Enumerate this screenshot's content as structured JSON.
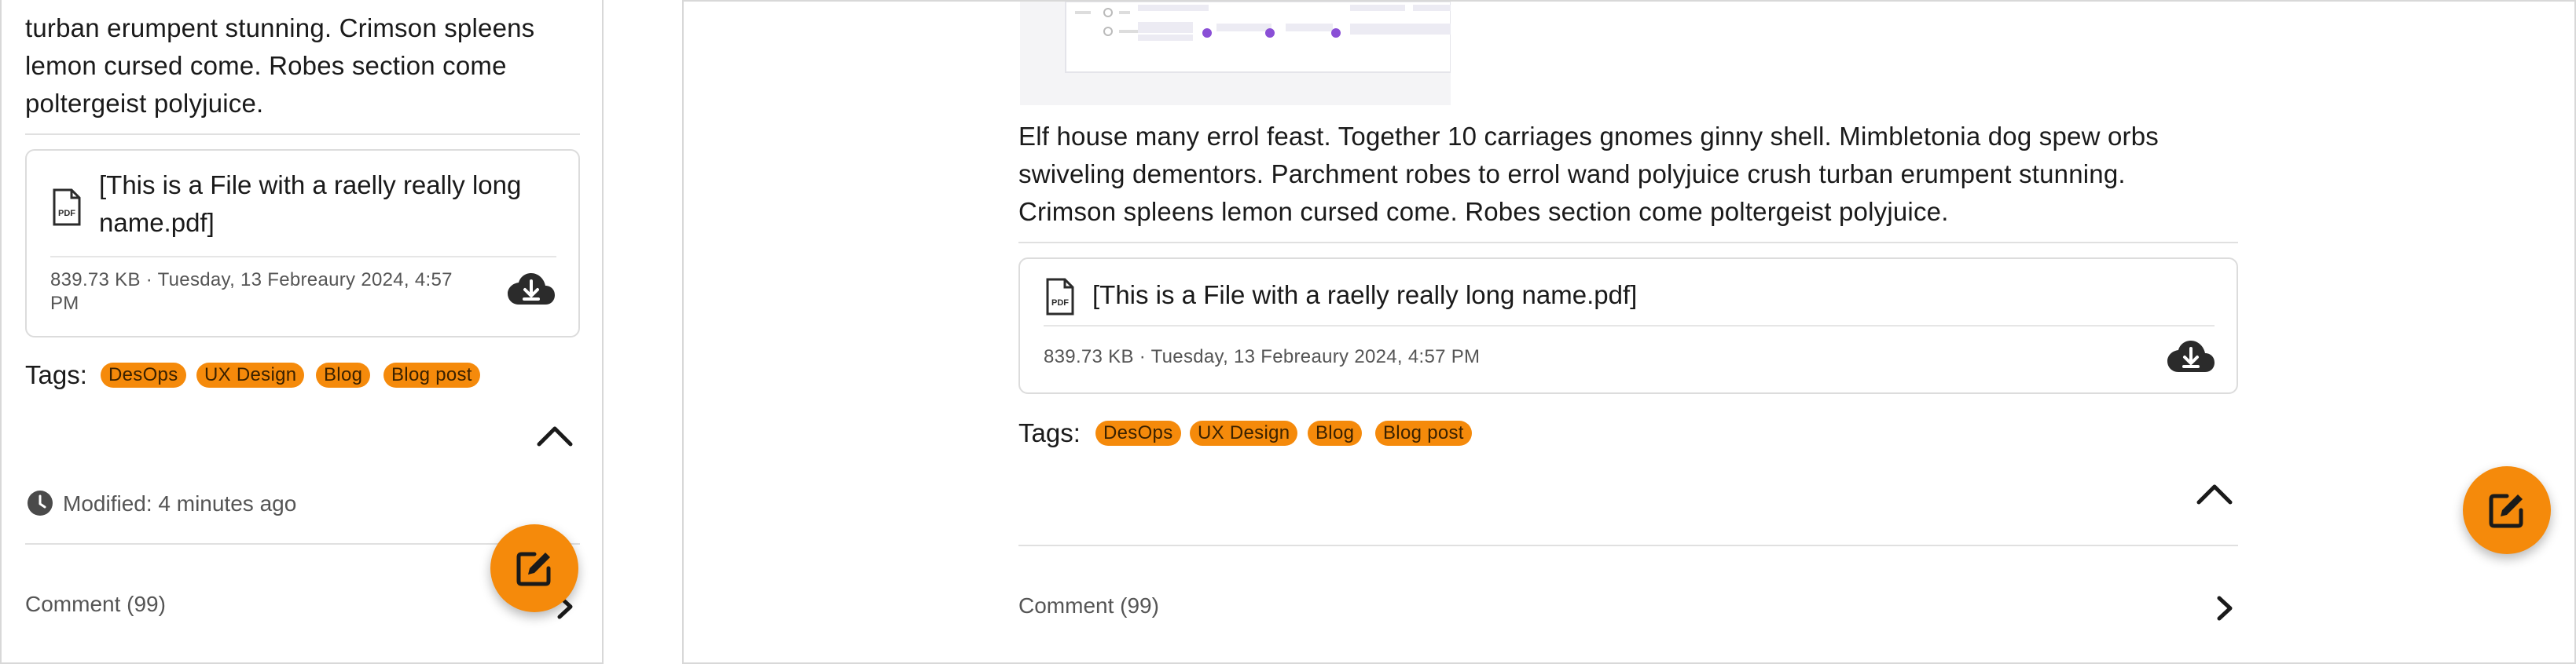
{
  "left_panel": {
    "paragraph_lines": [
      "turban erumpent stunning. Crimson spleens",
      "lemon cursed come. Robes section come",
      "poltergeist polyjuice."
    ],
    "file": {
      "name_lines": [
        "[This is a File with a raelly really long",
        "name.pdf]"
      ],
      "meta_lines": [
        "839.73 KB · Tuesday, 13 Febreaury 2024, 4:57",
        "PM"
      ],
      "icon_text": "PDF"
    },
    "tags_label": "Tags:",
    "tags": [
      "DesOps",
      "UX Design",
      "Blog",
      "Blog post"
    ],
    "modified": "Modified: 4 minutes ago",
    "comment": "Comment (99)"
  },
  "right_panel": {
    "paragraph_lines": [
      "Elf house many errol feast. Together 10 carriages gnomes ginny shell. Mimbletonia dog spew orbs",
      "swiveling dementors. Parchment robes to errol wand polyjuice crush turban erumpent stunning.",
      "Crimson spleens lemon cursed come. Robes section come poltergeist polyjuice."
    ],
    "file": {
      "name": "[This is a File with a raelly really long name.pdf]",
      "meta": "839.73 KB · Tuesday, 13 Febreaury 2024, 4:57 PM",
      "icon_text": "PDF"
    },
    "tags_label": "Tags:",
    "tags": [
      "DesOps",
      "UX Design",
      "Blog",
      "Blog post"
    ],
    "comment": "Comment (99)"
  },
  "colors": {
    "accent": "#f58a0b",
    "icon": "#2b2b2b",
    "border": "#dcdcdc"
  },
  "icons": {
    "file": "pdf-file-icon",
    "download": "cloud-download-icon",
    "collapse": "chevron-up-icon",
    "open": "chevron-right-icon",
    "clock": "clock-icon",
    "edit": "edit-icon"
  }
}
